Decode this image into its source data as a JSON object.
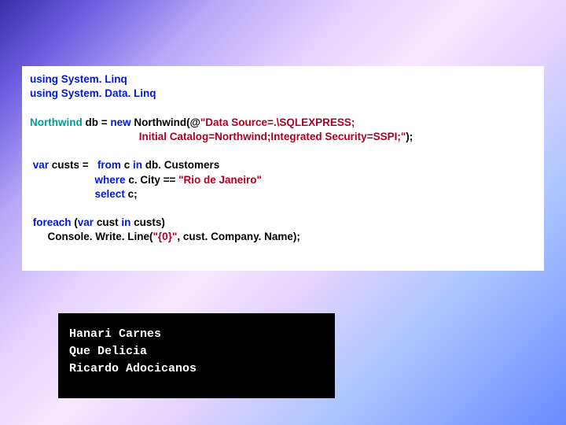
{
  "code": {
    "l1": "using System. Linq",
    "l2": "using System. Data. Linq",
    "l3_type": "Northwind",
    "l3_txt1": " db = ",
    "l3_kw": "new",
    "l3_txt2": " Northwind(@",
    "l3_str": "\"Data Source=.\\SQLEXPRESS;",
    "l4_indent": "                                     ",
    "l4_str": "Initial Catalog=Northwind;Integrated Security=SSPI;\"",
    "l4_txt": ");",
    "l5_kw1": " var",
    "l5_txt1": " custs =   ",
    "l5_kw2": "from",
    "l5_txt2": " c ",
    "l5_kw3": "in",
    "l5_txt3": " db. Customers",
    "l6_indent": "                      ",
    "l6_kw": "where",
    "l6_txt": " c. City == ",
    "l6_str": "\"Rio de Janeiro\"",
    "l7_indent": "                      ",
    "l7_kw": "select",
    "l7_txt": " c;",
    "l8_kw1": " foreach",
    "l8_txt1": " (",
    "l8_kw2": "var",
    "l8_txt2": " cust ",
    "l8_kw3": "in",
    "l8_txt3": " custs)",
    "l9_indent": "      ",
    "l9_txt1": "Console. Write. Line(",
    "l9_str": "\"{0}\"",
    "l9_txt2": ", cust. Company. Name);"
  },
  "output": {
    "line1": "Hanari Carnes",
    "line2": "Que Delicia",
    "line3": "Ricardo Adocicanos"
  }
}
